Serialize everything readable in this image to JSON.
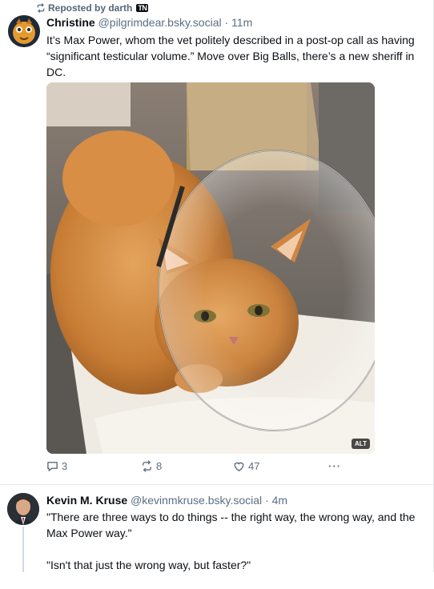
{
  "post1": {
    "repost_label": "Reposted by darth",
    "repost_badge": "TN",
    "author_name": "Christine",
    "author_handle": "@pilgrimdear.bsky.social",
    "separator": "·",
    "time": "11m",
    "text": "It’s Max Power, whom the vet politely described in a post-op call as having “significant testicular volume.” Move over Big Balls, there’s a new sheriff in DC.",
    "image_alt_badge": "ALT",
    "reply_count": "3",
    "repost_count": "8",
    "like_count": "47",
    "more_label": "···"
  },
  "post2": {
    "author_name": "Kevin M. Kruse",
    "author_handle": "@kevinmkruse.bsky.social",
    "separator": "·",
    "time": "4m",
    "paragraph1": "\"There are three ways to do things -- the right way, the wrong way, and the Max Power way.\"",
    "paragraph2": "\"Isn't that just the wrong way, but faster?\""
  },
  "colors": {
    "accent_text": "#0b0f14",
    "muted": "#5b6f82",
    "border": "#e3e8ee"
  },
  "icons": {
    "repost": "repost-icon",
    "reply": "reply-icon",
    "like": "heart-icon",
    "more": "more-icon"
  }
}
